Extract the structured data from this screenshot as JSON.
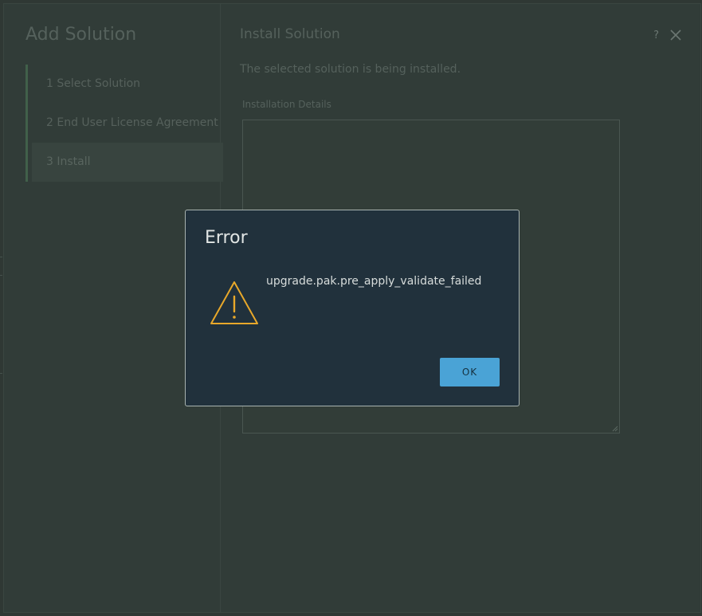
{
  "wizard": {
    "title": "Add Solution",
    "steps": [
      {
        "label": "1  Select Solution",
        "active": false
      },
      {
        "label": "2  End User License Agreement",
        "active": false
      },
      {
        "label": "3  Install",
        "active": true
      }
    ],
    "main": {
      "title": "Install Solution",
      "help_label": "?",
      "close_icon": "close-icon",
      "description": "The selected solution is being installed.",
      "details_label": "Installation Details",
      "details_value": ""
    }
  },
  "dialog": {
    "title": "Error",
    "icon": "warning-triangle-icon",
    "message": "upgrade.pak.pre_apply_validate_failed",
    "ok_label": "OK"
  },
  "colors": {
    "dialog_bg": "#21313c",
    "ok_button": "#4aa3d6",
    "warning": "#e8a82a",
    "overlay_bg": "#2f3834"
  }
}
